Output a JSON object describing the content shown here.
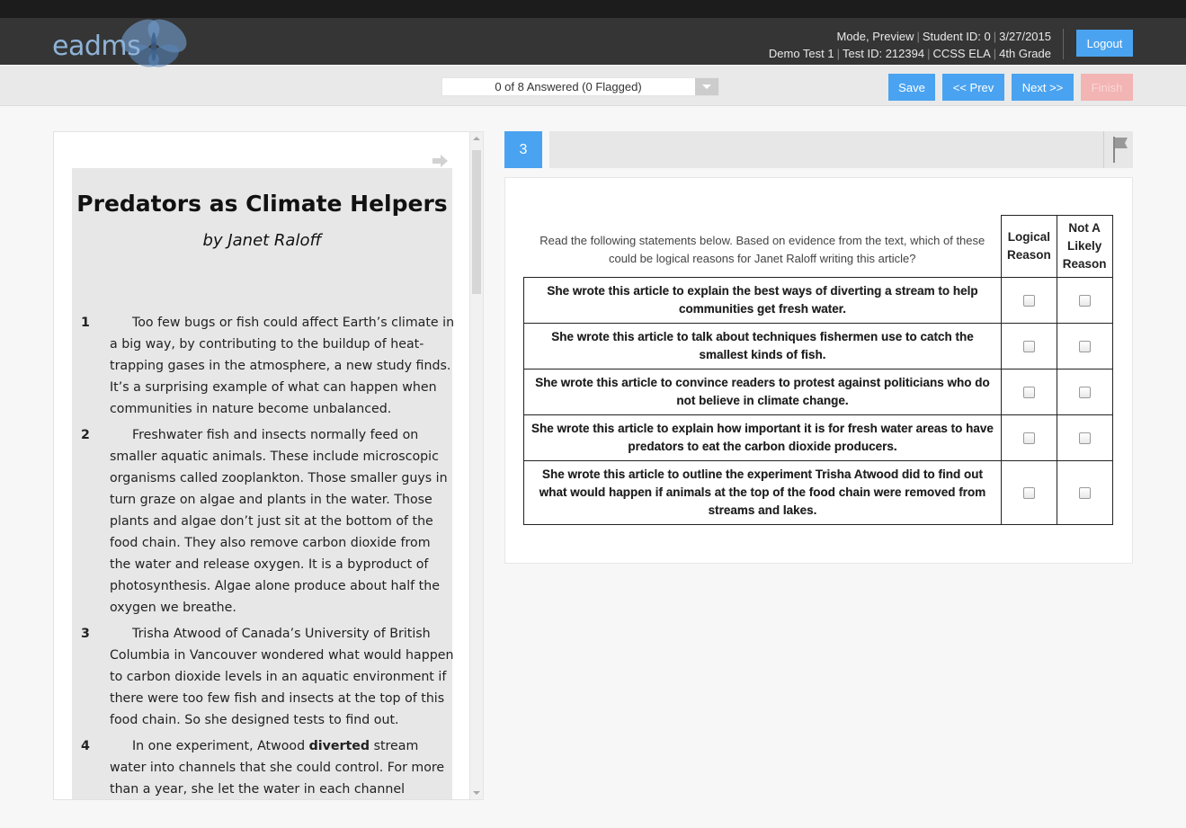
{
  "header": {
    "logo_text": "eadms",
    "info_line1": [
      "Mode, Preview",
      "Student ID: 0",
      "3/27/2015"
    ],
    "info_line2": [
      "Demo Test 1",
      "Test ID: 212394",
      "CCSS ELA",
      "4th Grade"
    ],
    "logout_label": "Logout"
  },
  "toolbar": {
    "answered_text": "0 of 8 Answered (0 Flagged)",
    "save_label": "Save",
    "prev_label": "<< Prev",
    "next_label": "Next >>",
    "finish_label": "Finish"
  },
  "passage": {
    "title": "Predators as Climate Helpers",
    "author": "by Janet Raloff",
    "paragraphs": [
      {
        "num": "1",
        "text": "Too few bugs or fish could affect Earth’s climate in a big way, by contributing to the buildup of heat-trapping gases in the atmosphere, a new study finds. It’s a surprising example of what can happen when communities in nature become unbalanced."
      },
      {
        "num": "2",
        "text": "Freshwater fish and insects normally feed on smaller aquatic animals. These include microscopic organisms called zooplankton. Those smaller guys in turn graze on algae and plants in the water. Those plants and algae don’t just sit at the bottom of the food chain. They also remove carbon dioxide from the water and release oxygen. It is a byproduct of photosynthesis. Algae alone produce about half the oxygen we breathe."
      },
      {
        "num": "3",
        "text": "Trisha Atwood of Canada’s University of British Columbia in Vancouver wondered what would happen to carbon dioxide levels in an aquatic environment if there were too few fish and insects at the top of this food chain. So she designed tests to find out."
      },
      {
        "num": "4",
        "text_before": "In one experiment, Atwood ",
        "bold": "diverted",
        "text_after": " stream water into channels that she could control. For more than a year, she let the water in each channel"
      }
    ]
  },
  "question": {
    "number": "3",
    "instructions": "Read the following statements below.  Based on evidence from the text, which of these could be logical reasons for Janet Raloff writing this article?",
    "col1": "Logical Reason",
    "col2": "Not A Likely Reason",
    "statements": [
      "She wrote this article to explain the best ways of diverting a stream to help communities get fresh water.",
      "She wrote this article to talk about techniques fishermen use to catch the smallest kinds of fish.",
      "She wrote this article to convince readers to protest against politicians who do not believe in climate change.",
      "She wrote this article to explain how important it is for fresh water areas to have predators to eat the carbon dioxide producers.",
      "She wrote this article to outline the experiment Trisha Atwood did to find out what would happen if animals at the top of the food chain were removed from streams and lakes."
    ]
  },
  "colors": {
    "accent": "#4aa3f0",
    "header_bg": "#353535",
    "finish_disabled": "#f3b4b4"
  }
}
